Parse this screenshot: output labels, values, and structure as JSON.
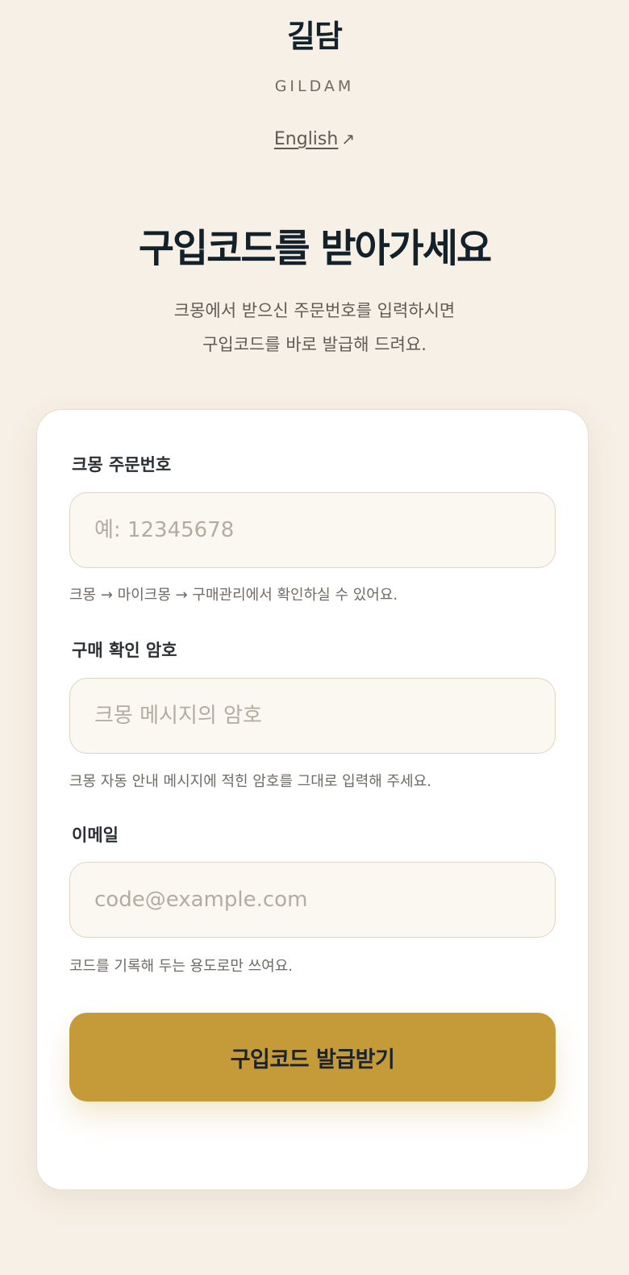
{
  "header": {
    "brand_ko": "길담",
    "brand_en": "GILDAM",
    "language_link": "English",
    "language_link_icon": "arrow-up-right-icon"
  },
  "main": {
    "title": "구입코드를 받아가세요",
    "subtitle_line1": "크몽에서 받으신 주문번호를 입력하시면",
    "subtitle_line2": "구입코드를 바로 발급해 드려요."
  },
  "form": {
    "order_number": {
      "label": "크몽 주문번호",
      "value": "",
      "placeholder": "예: 12345678",
      "hint": "크몽 → 마이크몽 → 구매관리에서 확인하실 수 있어요."
    },
    "password": {
      "label": "구매 확인 암호",
      "value": "",
      "placeholder": "크몽 메시지의 암호",
      "hint": "크몽 자동 안내 메시지에 적힌 암호를 그대로 입력해 주세요."
    },
    "email": {
      "label": "이메일",
      "value": "",
      "placeholder": "code@example.com",
      "hint": "코드를 기록해 두는 용도로만 쓰여요."
    },
    "submit_label": "구입코드 발급받기"
  },
  "colors": {
    "background": "#f7f0e6",
    "card": "#ffffff",
    "accent": "#c59b3a",
    "title": "#13212b",
    "input_background": "#fbf8f2",
    "input_border": "#dfd3c2"
  }
}
